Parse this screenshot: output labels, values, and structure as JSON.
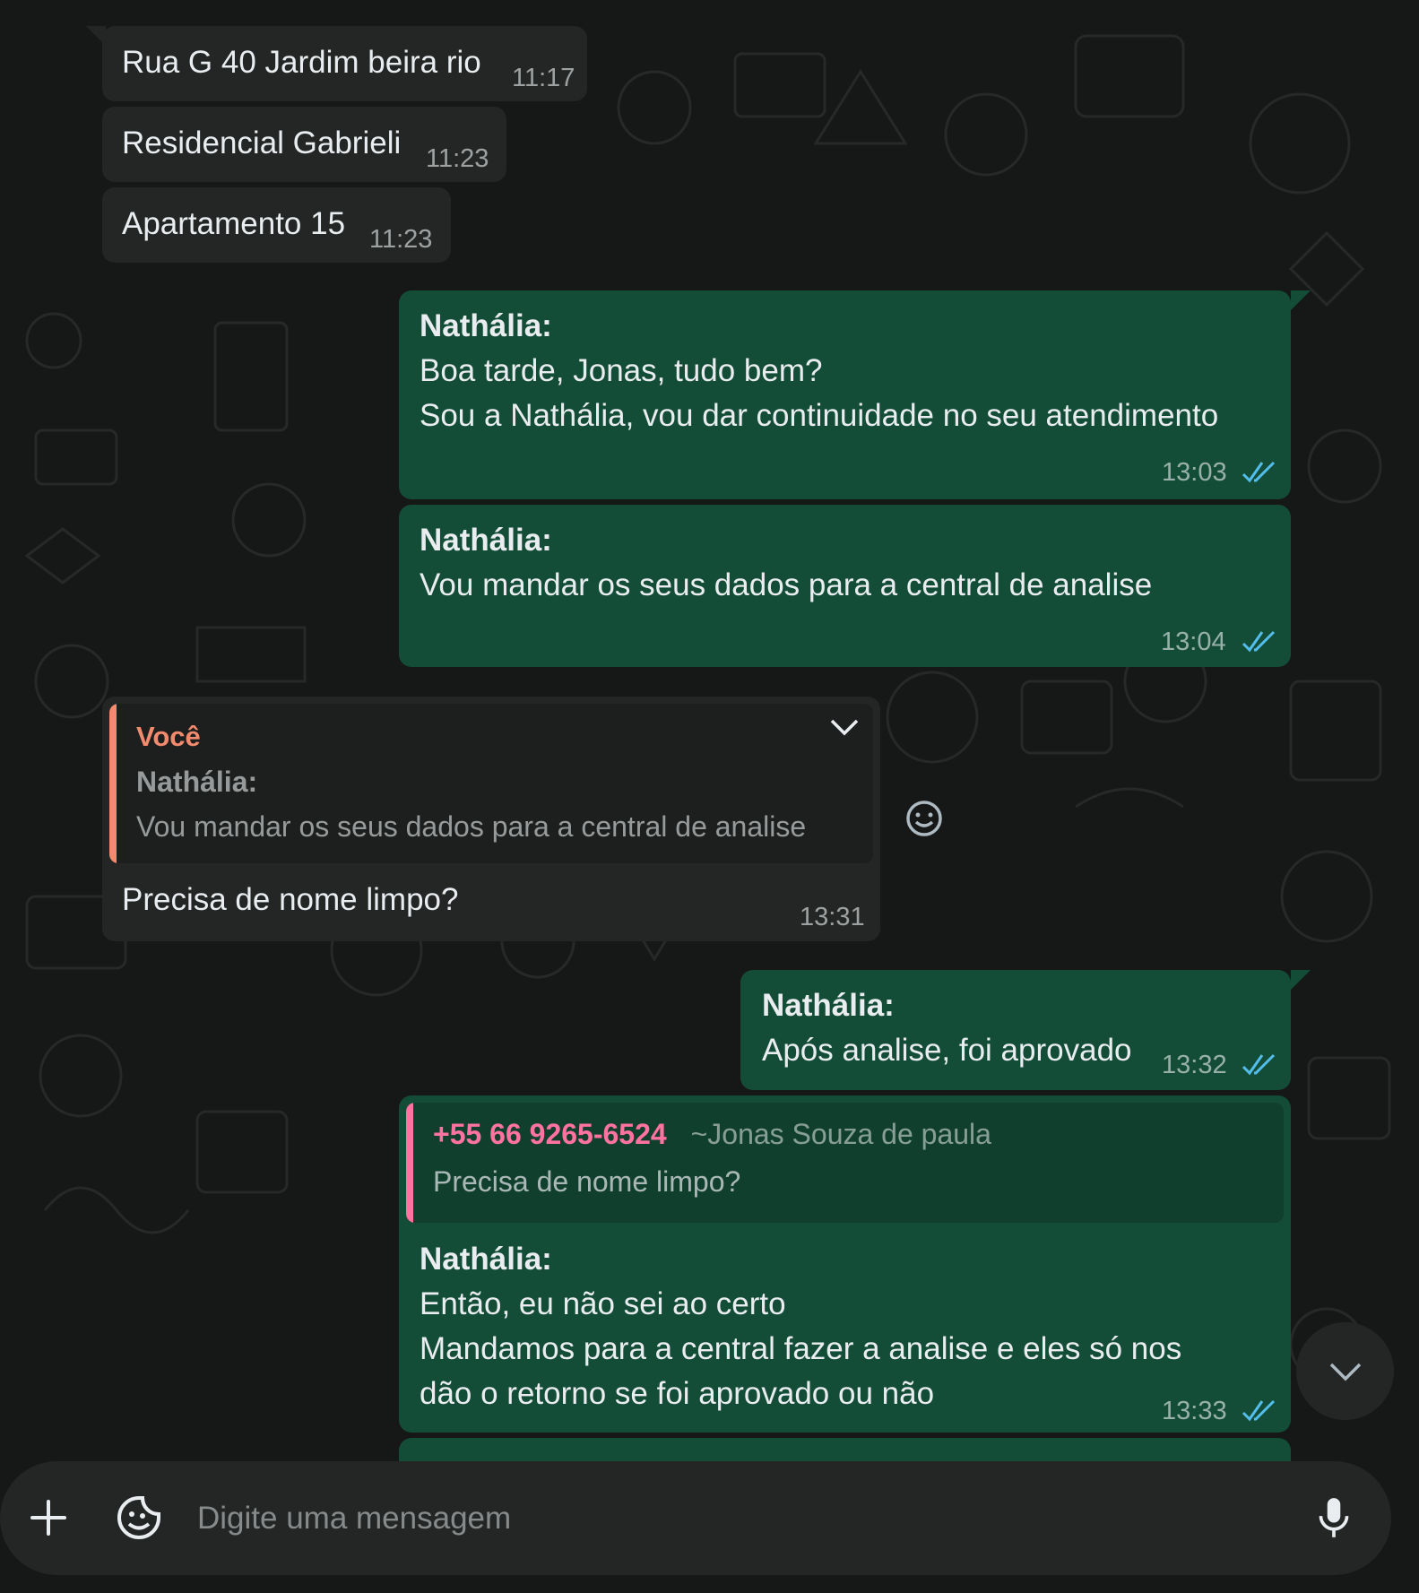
{
  "messages": {
    "m1": {
      "text": "Rua G 40 Jardim beira rio",
      "time": "11:17"
    },
    "m2": {
      "text": "Residencial Gabrieli",
      "time": "11:23"
    },
    "m3": {
      "text": "Apartamento 15",
      "time": "11:23"
    },
    "m4": {
      "sender": "Nathália",
      "line1": "Boa tarde, Jonas, tudo bem?",
      "line2": "Sou a Nathália, vou dar continuidade no seu atendimento",
      "time": "13:03"
    },
    "m5": {
      "sender": "Nathália",
      "line1": "Vou mandar os seus dados para a central de analise",
      "time": "13:04"
    },
    "m6": {
      "quote_author": "Você",
      "quote_sender": "Nathália",
      "quote_text": "Vou mandar os seus dados para a central de analise",
      "text": "Precisa de nome limpo?",
      "time": "13:31"
    },
    "m7": {
      "sender": "Nathália",
      "line1": "Após analise, foi aprovado",
      "time": "13:32"
    },
    "m8": {
      "quote_phone": "+55 66 9265-6524",
      "quote_name": "~Jonas Souza de paula",
      "quote_text": "Precisa de nome limpo?",
      "sender": "Nathália",
      "line1": "Então, eu não sei ao certo",
      "line2": "Mandamos para a central fazer a analise e eles só nos",
      "line3": "dão o retorno se foi aprovado ou não",
      "time": "13:33"
    }
  },
  "composer": {
    "placeholder": "Digite uma mensagem"
  },
  "colors": {
    "outgoing_bubble": "#144d37",
    "incoming_bubble": "#242626",
    "read_ticks": "#53bdeb",
    "quote_you": "#f28b6d",
    "quote_contact": "#ff72a1"
  },
  "icons": [
    "menu-down-icon",
    "emoji-icon",
    "double-check-icon",
    "scroll-down-icon",
    "plus-icon",
    "sticker-icon",
    "mic-icon"
  ]
}
